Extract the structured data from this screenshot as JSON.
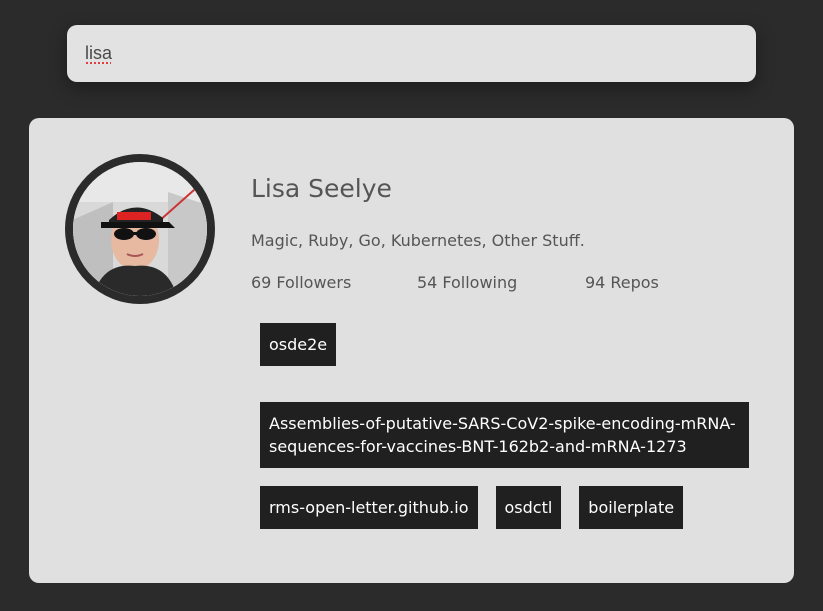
{
  "search": {
    "value": "lisa",
    "placeholder": ""
  },
  "profile": {
    "name": "Lisa Seelye",
    "bio": "Magic, Ruby, Go, Kubernetes, Other Stuff.",
    "followers_count": "69",
    "followers_label": "Followers",
    "following_count": "54",
    "following_label": "Following",
    "repos_count": "94",
    "repos_label": "Repos",
    "avatar_icon": "user-avatar-photo"
  },
  "repos": [
    "osde2e",
    "Assemblies-of-putative-SARS-CoV2-spike-encoding-mRNA-sequences-for-vaccines-BNT-162b2-and-mRNA-1273",
    "rms-open-letter.github.io",
    "osdctl",
    "boilerplate"
  ],
  "colors": {
    "page_background": "#2b2b2b",
    "card_background": "#e0e0e0",
    "search_background": "#e2e2e2",
    "repo_tag_background": "#202020",
    "repo_tag_text": "#ffffff",
    "text_muted": "#555555"
  }
}
